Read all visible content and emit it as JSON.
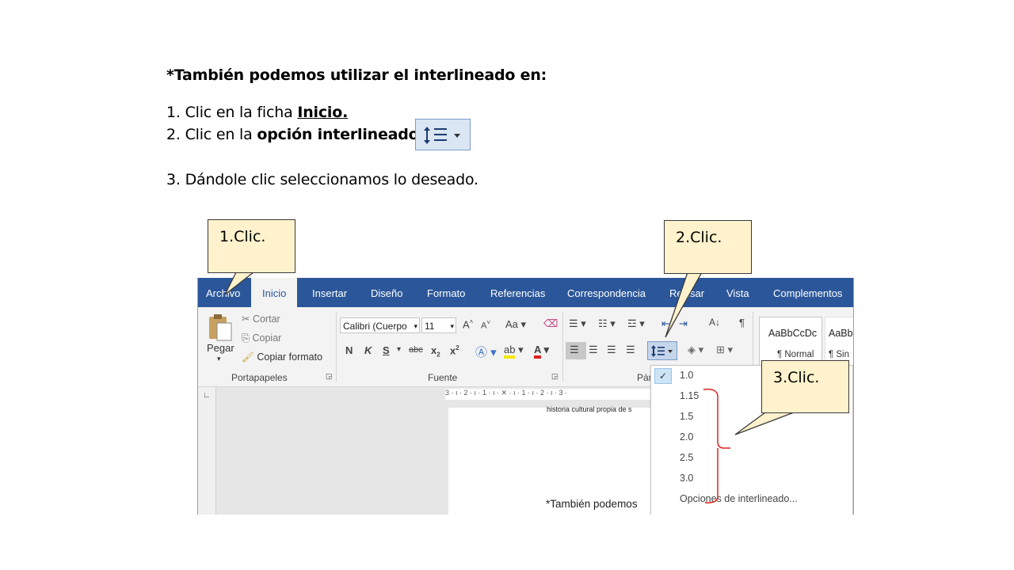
{
  "instructions": {
    "heading": "*También podemos utilizar el interlineado en:",
    "step1_prefix": "1. Clic en la ficha ",
    "step1_bold": "Inicio.",
    "step2_prefix": "2. Clic en la ",
    "step2_bold": "opción interlineado.",
    "step3": "3. Dándole clic seleccionamos lo deseado."
  },
  "callouts": {
    "c1": "1.Clic.",
    "c2": "2.Clic.",
    "c3": "3.Clic."
  },
  "ribbon_tabs": [
    "Archivo",
    "Inicio",
    "Insertar",
    "Diseño",
    "Formato",
    "Referencias",
    "Correspondencia",
    "Revisar",
    "Vista",
    "Complementos"
  ],
  "clipboard": {
    "paste": "Pegar",
    "cut": "Cortar",
    "copy": "Copiar",
    "format_painter": "Copiar formato",
    "group_label": "Portapapeles"
  },
  "font": {
    "name": "Calibri (Cuerpo",
    "size": "11",
    "bold": "N",
    "italic": "K",
    "underline": "S",
    "group_label": "Fuente"
  },
  "paragraph": {
    "group_label": "Pár"
  },
  "styles": {
    "sample1": "AaBbCcDc",
    "label1": "¶ Normal",
    "sample2": "AaBb",
    "label2": "¶ Sin"
  },
  "document": {
    "line1": "historia cultural propia de s",
    "line2": "*También podemos",
    "ruler": "3 · ı · 2 · ı · 1 · ı · ✕ · ı · 1 · ı · 2 · ı · 3 ·"
  },
  "line_spacing_menu": {
    "selected": "1.0",
    "options": [
      "1.0",
      "1.15",
      "1.5",
      "2.0",
      "2.5",
      "3.0"
    ],
    "more": "Opciones de interlineado..."
  },
  "colors": {
    "tab_bar": "#2b579a",
    "callout_fill": "#fff2cc",
    "bracket": "#e02020"
  }
}
